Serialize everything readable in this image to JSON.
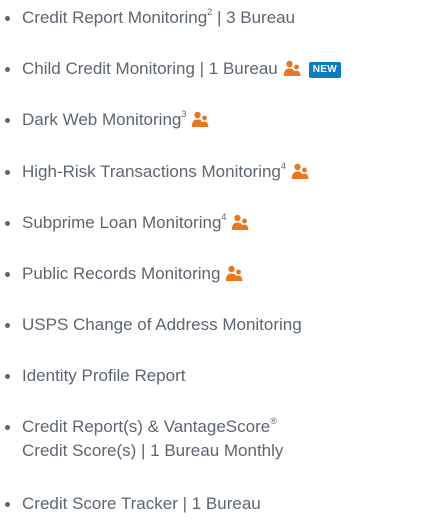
{
  "features": {
    "items": [
      {
        "text": "Credit Report Monitoring",
        "sup": "2",
        "suffix": " | 3 Bureau",
        "family": false,
        "badge": ""
      },
      {
        "text": "Child Credit Monitoring | 1 Bureau",
        "sup": "",
        "suffix": "",
        "family": true,
        "badge": "NEW"
      },
      {
        "text": "Dark Web Monitoring",
        "sup": "3",
        "suffix": "",
        "family": true,
        "badge": ""
      },
      {
        "text": "High-Risk Transactions Monitoring",
        "sup": "4",
        "suffix": "",
        "family": true,
        "badge": ""
      },
      {
        "text": "Subprime Loan Monitoring",
        "sup": "4",
        "suffix": "",
        "family": true,
        "badge": ""
      },
      {
        "text": "Public Records Monitoring",
        "sup": "",
        "suffix": "",
        "family": true,
        "badge": ""
      },
      {
        "text": "USPS Change of Address Monitoring",
        "sup": "",
        "suffix": "",
        "family": false,
        "badge": ""
      },
      {
        "text": "Identity Profile Report",
        "sup": "",
        "suffix": "",
        "family": false,
        "badge": ""
      },
      {
        "text": "Credit Report(s) & VantageScore",
        "sup": "®",
        "suffix": "\nCredit Score(s) | 1 Bureau Monthly",
        "family": false,
        "badge": ""
      },
      {
        "text": "Credit Score Tracker | 1 Bureau",
        "sup": "",
        "suffix": "",
        "family": false,
        "badge": ""
      }
    ]
  },
  "colors": {
    "text": "#5c6670",
    "icon": "#e87722",
    "badge": "#0a7ec2"
  },
  "icons": {
    "family": "family-icon"
  }
}
